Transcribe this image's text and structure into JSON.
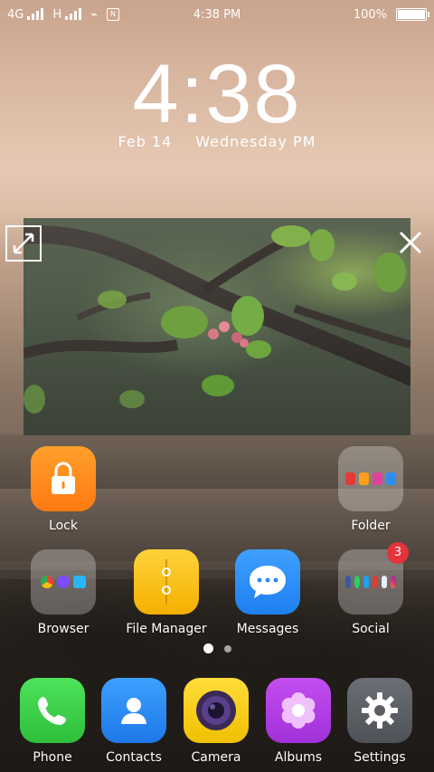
{
  "status_bar": {
    "network_1": "4G",
    "network_2": "H",
    "time": "4:38 PM",
    "battery": "100%"
  },
  "lockclock": {
    "time": "4:38",
    "date": "Feb 14",
    "day": "Wednesday",
    "ampm": "PM"
  },
  "apps": {
    "lock": {
      "label": "Lock",
      "color": "#ff8a1a"
    },
    "folder": {
      "label": "Folder"
    },
    "browser": {
      "label": "Browser"
    },
    "file_manager": {
      "label": "File Manager",
      "color": "#f5b700"
    },
    "messages": {
      "label": "Messages",
      "color": "#2c8ef5"
    },
    "social": {
      "label": "Social",
      "badge": "3"
    }
  },
  "dock": {
    "phone": {
      "label": "Phone",
      "color": "#3ed14a"
    },
    "contacts": {
      "label": "Contacts",
      "color": "#2c8cf0"
    },
    "camera": {
      "label": "Camera",
      "color": "#f6cf21"
    },
    "albums": {
      "label": "Albums",
      "color": "#b23ee0"
    },
    "settings": {
      "label": "Settings",
      "color": "#5f6368"
    }
  },
  "pager": {
    "pages": 2,
    "active": 1
  }
}
